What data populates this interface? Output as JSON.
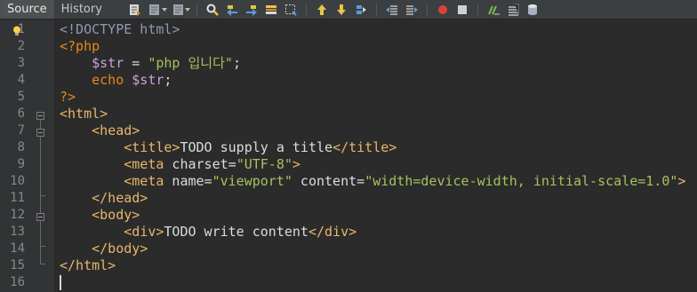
{
  "tabs": [
    {
      "label": "Source"
    },
    {
      "label": "History"
    }
  ],
  "toolbar_icons": [
    "last-edit-icon",
    "back-icon",
    "forward-icon",
    "find-icon",
    "find-previous-icon",
    "find-next-icon",
    "toggle-highlight-icon",
    "toggle-rect-selection-icon",
    "previous-bookmark-icon",
    "next-bookmark-icon",
    "toggle-bookmark-icon",
    "shift-left-icon",
    "shift-right-icon",
    "start-macro-icon",
    "stop-macro-icon",
    "comment-icon",
    "uncomment-icon",
    "database-icon"
  ],
  "line_numbers": [
    "1",
    "2",
    "3",
    "4",
    "5",
    "6",
    "7",
    "8",
    "9",
    "10",
    "11",
    "12",
    "13",
    "14",
    "15",
    "16"
  ],
  "code": {
    "l1": {
      "t1": "<!DOCTYPE html>"
    },
    "l2": {
      "t1": "<?php"
    },
    "l3": {
      "indent": "    ",
      "t1": "$str",
      "t2": " = ",
      "t3": "\"php 입니다\"",
      "t4": ";"
    },
    "l4": {
      "indent": "    ",
      "t1": "echo",
      "t2": " ",
      "t3": "$str",
      "t4": ";"
    },
    "l5": {
      "t1": "?>"
    },
    "l6": {
      "t1": "<html>"
    },
    "l7": {
      "indent": "    ",
      "t1": "<head>"
    },
    "l8": {
      "indent": "        ",
      "t1": "<title>",
      "t2": "TODO supply a title",
      "t3": "</title>"
    },
    "l9": {
      "indent": "        ",
      "t1": "<meta",
      "t2": " charset=",
      "t3": "\"UTF-8\"",
      "t4": ">"
    },
    "l10": {
      "indent": "        ",
      "t1": "<meta",
      "t2": " name=",
      "t3": "\"viewport\"",
      "t4": " content=",
      "t5": "\"width=device-width, initial-scale=1.0\"",
      "t6": ">"
    },
    "l11": {
      "indent": "    ",
      "t1": "</head>"
    },
    "l12": {
      "indent": "    ",
      "t1": "<body>"
    },
    "l13": {
      "indent": "        ",
      "t1": "<div>",
      "t2": "TODO write content",
      "t3": "</div>"
    },
    "l14": {
      "indent": "    ",
      "t1": "</body>"
    },
    "l15": {
      "t1": "</html>"
    },
    "l16": {
      "t1": ""
    }
  },
  "colors": {
    "background": "#2b2b2b",
    "gutter": "#313335",
    "tag": "#e8b66a",
    "php_delimiter": "#e5881a",
    "variable": "#c9a0dc",
    "string": "#a5c25c",
    "doctype": "#8f99b3"
  }
}
